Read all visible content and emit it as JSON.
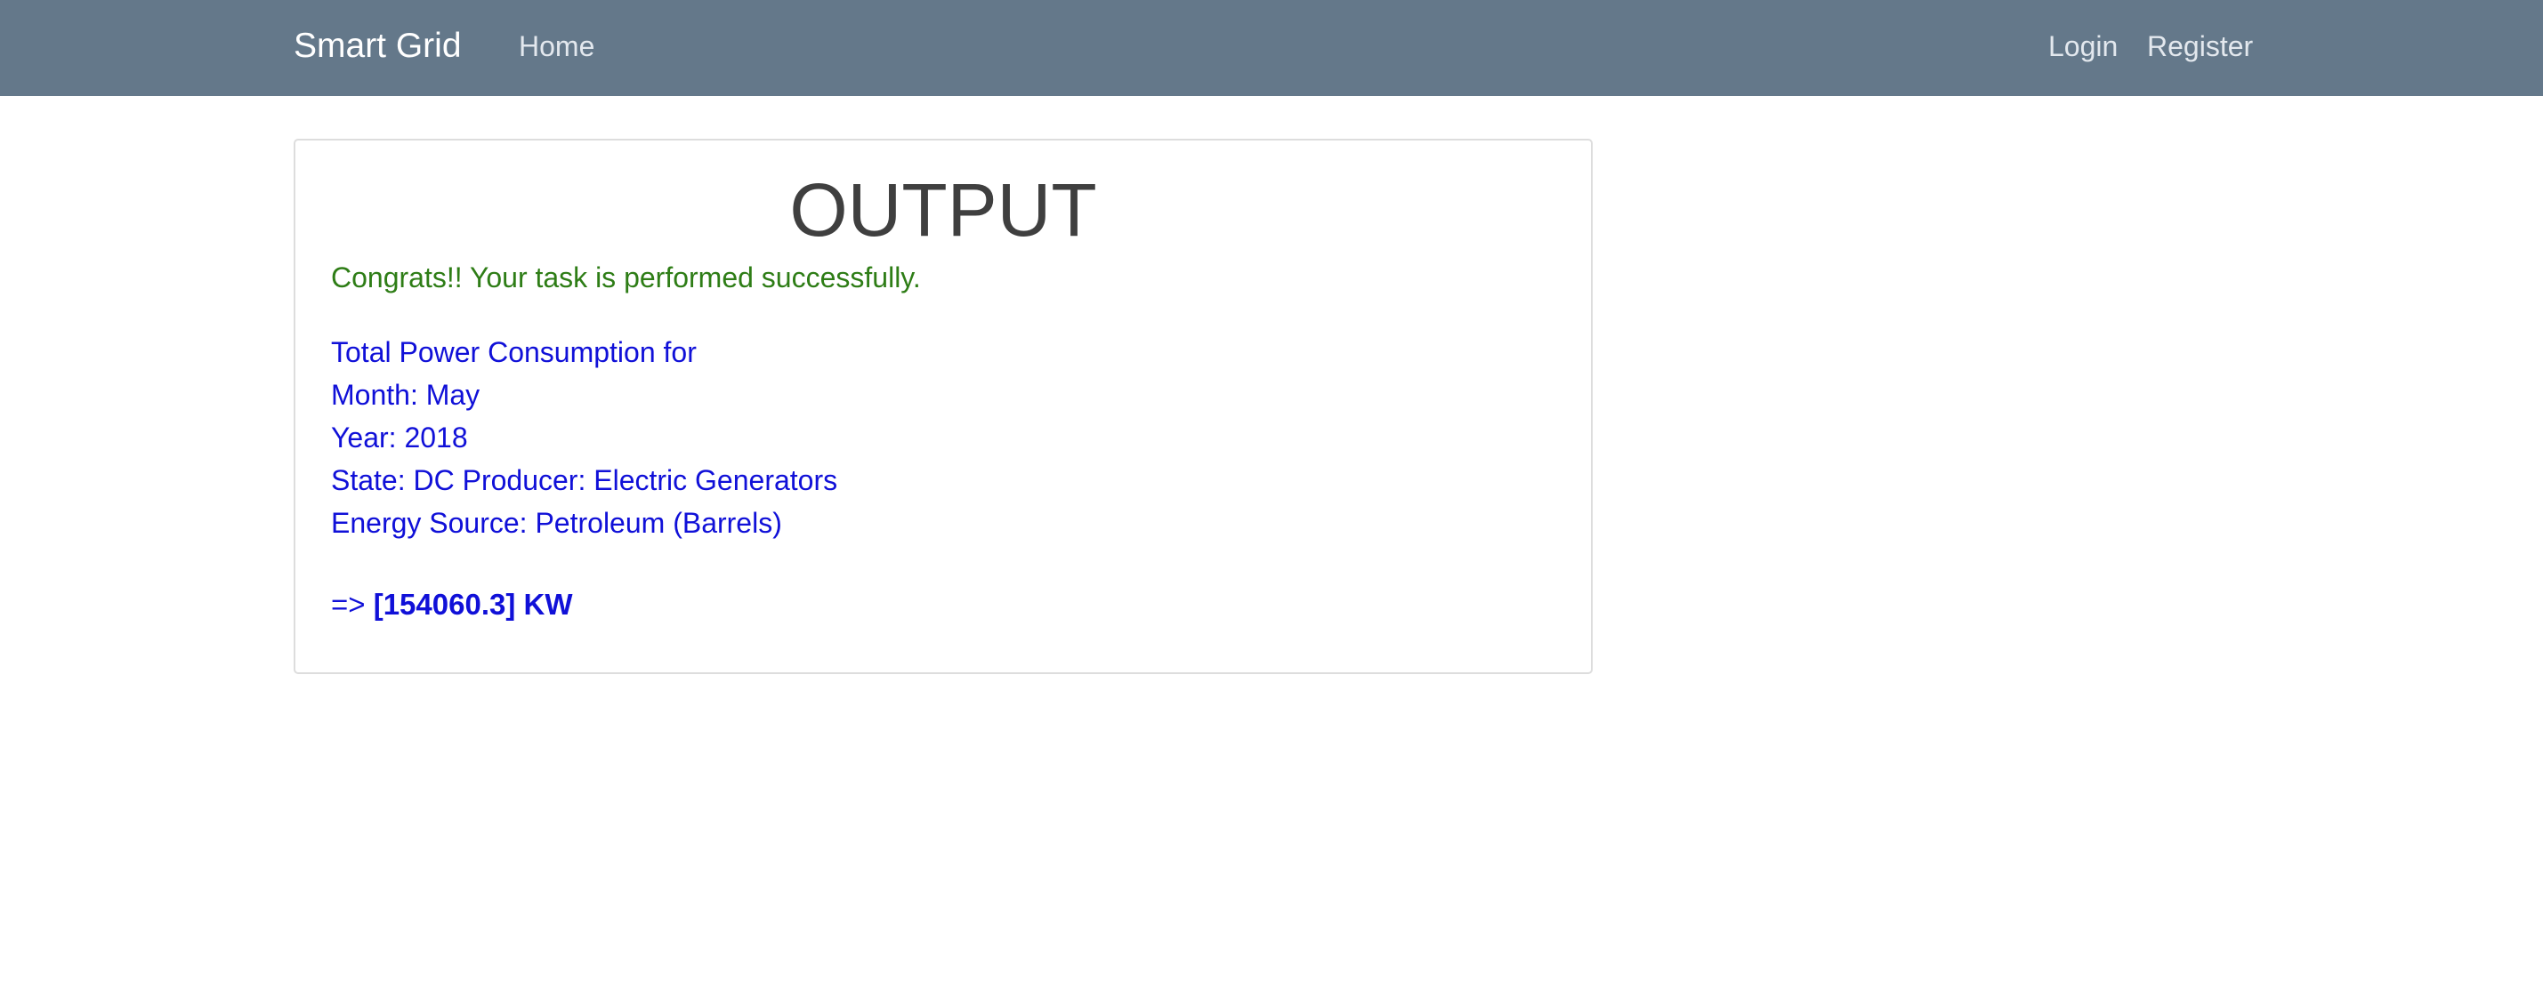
{
  "navbar": {
    "brand": "Smart Grid",
    "links_left": [
      "Home"
    ],
    "links_right": [
      "Login",
      "Register"
    ]
  },
  "card": {
    "title": "OUTPUT",
    "success_message": "Congrats!! Your task is performed successfully.",
    "details": [
      "Total Power Consumption for",
      "Month: May",
      "Year: 2018",
      "State: DC Producer: Electric Generators",
      "Energy Source: Petroleum (Barrels)"
    ],
    "result_prefix": "=>",
    "result_value": "[154060.3] KW"
  },
  "colors": {
    "navbar_bg": "#64788a",
    "success_text": "#2e7d16",
    "result_text": "#1010d8"
  }
}
